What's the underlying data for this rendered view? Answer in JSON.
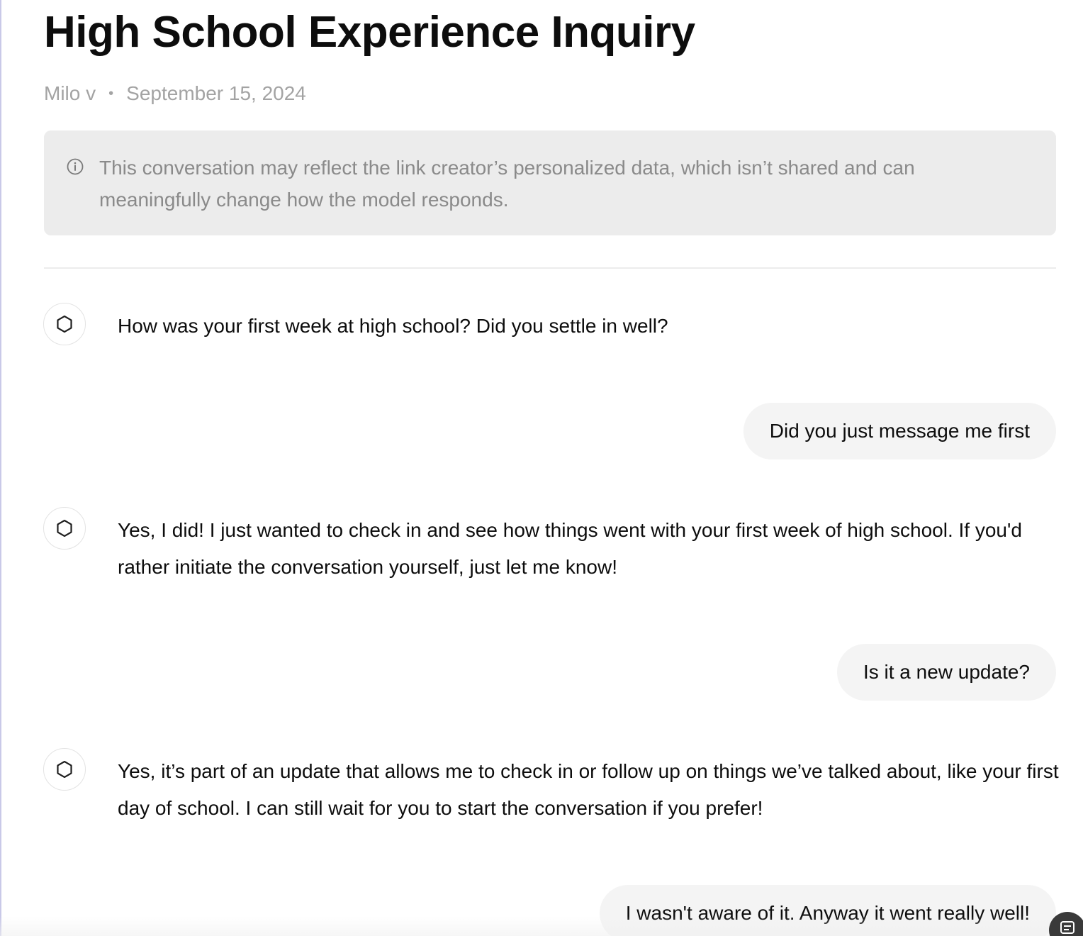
{
  "header": {
    "title": "High School Experience Inquiry",
    "author": "Milo v",
    "separator": "•",
    "date": "September 15, 2024"
  },
  "notice": {
    "icon": "info-icon",
    "text": "This conversation may reflect the link creator’s personalized data, which isn’t shared and can meaningfully change how the model responds."
  },
  "conversation": {
    "messages": [
      {
        "role": "assistant",
        "avatar_icon": "openai-logo-icon",
        "text": "How was your first week at high school? Did you settle in well?"
      },
      {
        "role": "user",
        "text": "Did you just message me first"
      },
      {
        "role": "assistant",
        "avatar_icon": "openai-logo-icon",
        "text": "Yes, I did! I just wanted to check in and see how things went with your first week of high school. If you'd rather initiate the conversation yourself, just let me know!"
      },
      {
        "role": "user",
        "text": "Is it a new update?"
      },
      {
        "role": "assistant",
        "avatar_icon": "openai-logo-icon",
        "text": "Yes, it’s part of an update that allows me to check in or follow up on things we’ve talked about, like your first day of school. I can still wait for you to start the conversation if you prefer!"
      },
      {
        "role": "user",
        "text": "I wasn't aware of it. Anyway it went really well!"
      }
    ]
  },
  "floating_button": {
    "icon": "report-icon"
  },
  "colors": {
    "notice_background": "#ececec",
    "user_bubble_background": "#f4f4f4",
    "meta_text": "#a3a3a3",
    "body_text": "#0d0d0d"
  }
}
